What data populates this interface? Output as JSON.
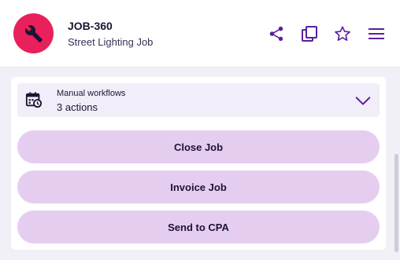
{
  "header": {
    "avatar_icon": "wrench-icon",
    "avatar_color": "#e8205c",
    "job_id": "JOB-360",
    "job_name": "Street Lighting Job",
    "actions": [
      "share-icon",
      "copy-icon",
      "star-icon",
      "menu-icon"
    ]
  },
  "workflows": {
    "icon": "calendar-clock-icon",
    "title": "Manual workflows",
    "count": "3 actions"
  },
  "buttons": [
    {
      "label": "Close Job"
    },
    {
      "label": "Invoice Job"
    },
    {
      "label": "Send to CPA"
    }
  ],
  "colors": {
    "accent": "#5b1f9e",
    "button_bg": "#e5cdf0",
    "panel_bg": "#f1eef9"
  }
}
